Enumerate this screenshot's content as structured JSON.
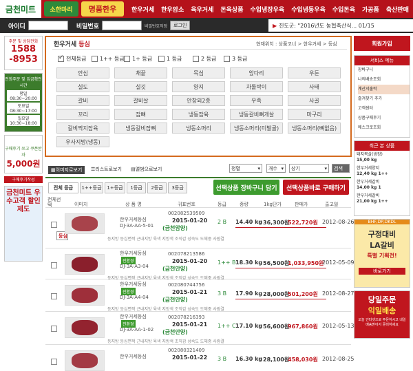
{
  "header": {
    "logo": "금천미트",
    "badge1": "소한마리",
    "badge2": "명품한우",
    "nav": [
      "한우거세",
      "한우암소",
      "육우거세",
      "돈육상품",
      "수입냉장우육",
      "수입냉동우육",
      "수입돈육",
      "가공품",
      "축산판매"
    ]
  },
  "login": {
    "id_label": "아이디",
    "pw_label": "비밀번호",
    "save_label": "비밀번호저장",
    "login_button": "로그인",
    "ticker": "진도군: \"2016년도 농협축산식... 01/15"
  },
  "left": {
    "title": "주문 및 상담전화",
    "phone1": "1588",
    "phone2": "-8953",
    "hours_title": "전화주문 및 입금확인시간",
    "hours": [
      "평일 08:30~20:00",
      "토요일 08:30~17:00",
      "일요일 10:30~18:00"
    ],
    "review_text": "구매후기 쓰고 쿠폰받자",
    "review_amount": "5,000원",
    "review_tag": "구매후기작성",
    "promo": "금천미트 우수고객 할인제도"
  },
  "main": {
    "title_a": "한우거세",
    "title_b": "등심",
    "breadcrumb": "현재위치 : 상품코너 > 한우거세 > 등심",
    "grades": [
      "전체등급",
      "1++ 등급",
      "1+ 등급",
      "1 등급",
      "2 등급",
      "3 등급"
    ],
    "parts": [
      "안심",
      "등심",
      "채끝",
      "목심",
      "앞다리",
      "우둔",
      "설도",
      "설깃",
      "양지",
      "차돌박이",
      "사태",
      "갈비",
      "갈비살",
      "안창외2종",
      "우족",
      "사골",
      "꼬리",
      "잡뼈",
      "냉동잡육",
      "냉동갈비뼈개살",
      "마구리",
      "갈비짝지잡육",
      "냉동갈비잡뼈",
      "냉동소머리",
      "냉동소머리(미발골)",
      "냉동소머리(뼈없음)",
      "우사지방(냉동)"
    ]
  },
  "toolbar": {
    "view_image": "이미지로보기",
    "view_list": "리스트로보기",
    "view_gallery": "앨범으로보기",
    "sort": "정렬",
    "count": "개수",
    "state": "상기",
    "search": "검색"
  },
  "tabs": [
    "전체 등급",
    "1++등급",
    "1+등급",
    "1등급",
    "2등급",
    "3등급"
  ],
  "buttons": {
    "cart": "선택상품 장바구니 담기",
    "buy": "선택상품바로 구매하기"
  },
  "columns": [
    "전체선택",
    "이미지",
    "상 품 명",
    "귀표번호",
    "등급",
    "중량",
    "1kg단가",
    "판매가",
    "출고일"
  ],
  "rows": [
    {
      "name": "한우거세등심",
      "code": "DJ-3A-AA-5-01",
      "tag": "",
      "ear": "002082539509",
      "date": "2015-01-20",
      "place": "(금천암양)",
      "grade": "2 B",
      "weight": "14.40 kg",
      "unit": "36,300원",
      "price": "522,720원",
      "out": "2012-08-26"
    },
    {
      "name": "한우거세등심",
      "code": "DJ-3A-A3-04",
      "tag": "진환경",
      "ear": "002078213586",
      "date": "2015-01-20",
      "place": "(금천안양)",
      "grade": "1++ B",
      "weight": "18.30 kg",
      "unit": "56,500원",
      "price": "1,033,950원",
      "out": "2012-05-09"
    },
    {
      "name": "한우거세등심",
      "code": "DJ-3A-A4-04",
      "tag": "진환경",
      "ear": "002080744756",
      "date": "2015-01-21",
      "place": "(금천안양)",
      "grade": "3 B",
      "weight": "17.90 kg",
      "unit": "28,000원",
      "price": "501,200원",
      "out": "2012-08-27"
    },
    {
      "name": "한우거세등심",
      "code": "DJ-3A-AA-1-02",
      "tag": "진환경",
      "ear": "002078216393",
      "date": "2015-01-21",
      "place": "(금천안양)",
      "grade": "1++ C",
      "weight": "17.10 kg",
      "unit": "56,600원",
      "price": "967,860원",
      "out": "2012-05-13"
    },
    {
      "name": "한우거세등심",
      "code": "",
      "tag": "",
      "ear": "002080321409",
      "date": "2015-01-22",
      "place": "",
      "grade": "3 B",
      "weight": "16.30 kg",
      "unit": "28,100원",
      "price": "458,030원",
      "out": "2012-08-25"
    }
  ],
  "subrow": "등지방 등심면적 근내지방 육색 지방색 조직감 성숙도 도체중 사람결",
  "right": {
    "join": "회원가입",
    "service_title": "서비스 메뉴",
    "services": [
      "장바구니",
      "나의배송조회",
      "계산서출력",
      "즐겨찾기 추가",
      "고객센터",
      "상품구매후기",
      "에스크로조회"
    ],
    "recent_title": "최근 본 상품",
    "recent": [
      {
        "name": "돼지목살(냉장)",
        "price": "15,00 kg"
      },
      {
        "name": "한우거세양지",
        "price": "12,40 kg 1++"
      },
      {
        "name": "한우거세갈비",
        "price": "14,00 kg 1"
      },
      {
        "name": "한우거세갈비",
        "price": "21,00 kg 1++"
      }
    ],
    "banner1_top": "BHF,DP,DKDL",
    "banner1_a": "구정대비",
    "banner1_b": "LA갈비",
    "banner1_c": "특별 기획전!",
    "banner1_go": "바로가기",
    "banner2_a": "당일주문",
    "banner2_b": "익일배송",
    "banner2_c": "오늘 인터넷으로 주문하시고 내일 배송받아서 준비하세요"
  }
}
